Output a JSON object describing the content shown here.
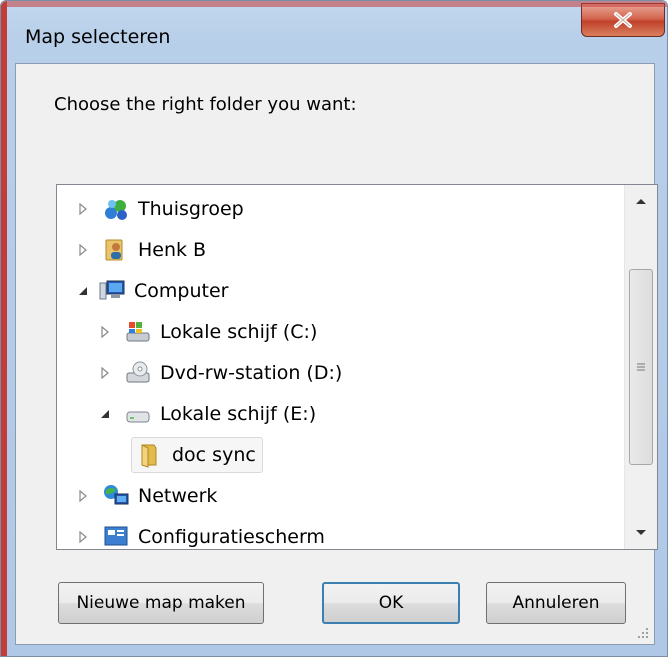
{
  "window": {
    "title": "Map selecteren",
    "close_icon": "close-icon"
  },
  "prompt": "Choose the right folder you want:",
  "tree": {
    "items": [
      {
        "label": "Thuisgroep",
        "icon": "homegroup-icon",
        "expanded": false,
        "level": 0
      },
      {
        "label": "Henk B",
        "icon": "user-folder-icon",
        "expanded": false,
        "level": 0
      },
      {
        "label": "Computer",
        "icon": "computer-icon",
        "expanded": true,
        "level": 0
      },
      {
        "label": "Lokale schijf (C:)",
        "icon": "system-drive-icon",
        "expanded": false,
        "level": 1
      },
      {
        "label": "Dvd-rw-station (D:)",
        "icon": "dvd-drive-icon",
        "expanded": false,
        "level": 1
      },
      {
        "label": "Lokale schijf (E:)",
        "icon": "drive-icon",
        "expanded": true,
        "level": 1
      },
      {
        "label": "doc sync",
        "icon": "folder-icon",
        "selected": true,
        "level": 2
      },
      {
        "label": "Netwerk",
        "icon": "network-icon",
        "expanded": false,
        "level": 0
      },
      {
        "label": "Configuratiescherm",
        "icon": "control-panel-icon",
        "expanded": false,
        "level": 0
      }
    ]
  },
  "buttons": {
    "new_folder": "Nieuwe map maken",
    "ok": "OK",
    "cancel": "Annuleren"
  }
}
